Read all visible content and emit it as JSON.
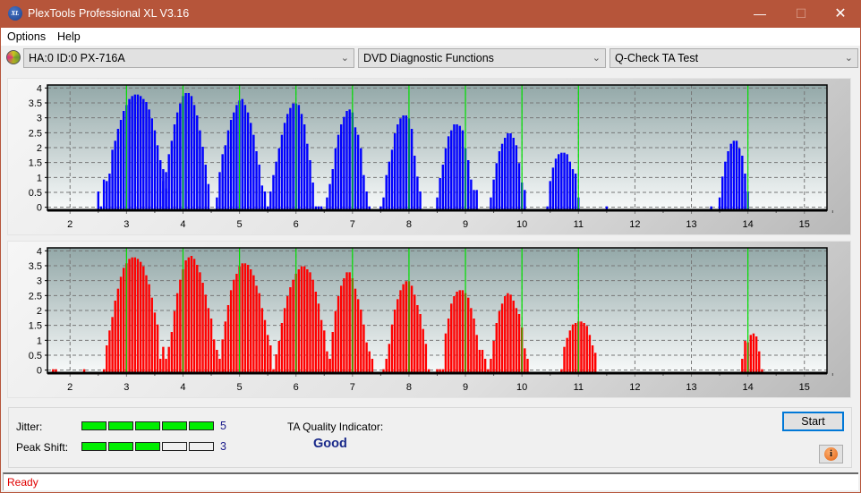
{
  "window": {
    "title": "PlexTools Professional XL V3.16",
    "icon": "xl-logo-icon",
    "controls": [
      "minimize",
      "maximize",
      "close"
    ]
  },
  "menu": [
    {
      "label": "Options"
    },
    {
      "label": "Help"
    }
  ],
  "toolbar": {
    "drive": "HA:0 ID:0  PX-716A",
    "function": "DVD Diagnostic Functions",
    "test": "Q-Check TA Test"
  },
  "results": {
    "jitter_label": "Jitter:",
    "jitter_value": "5",
    "jitter_level": 5,
    "peak_shift_label": "Peak Shift:",
    "peak_shift_value": "3",
    "peak_shift_level": 3,
    "max_level": 5,
    "ta_quality_label": "TA Quality Indicator:",
    "ta_quality_value": "Good",
    "level_color": "#00ee00"
  },
  "buttons": {
    "start": "Start",
    "info": "i"
  },
  "status": {
    "text": "Ready",
    "color": "#e00000"
  },
  "chart_data": [
    {
      "type": "bar",
      "name": "top-chart",
      "color": "#0000ff",
      "marker_color": "#00e000",
      "x_ticks": [
        2,
        3,
        4,
        5,
        6,
        7,
        8,
        9,
        10,
        11,
        12,
        13,
        14,
        15
      ],
      "y_ticks": [
        "0",
        "0.5",
        "1",
        "1.5",
        "2",
        "2.5",
        "3",
        "3.5",
        "4"
      ],
      "xlim": [
        1.6,
        15.4
      ],
      "ylim": [
        -0.1,
        4.1
      ],
      "grid": true,
      "markers": [
        3,
        4,
        5,
        6,
        7,
        8,
        9,
        10,
        11,
        14
      ],
      "bin_step": 0.05,
      "peaks": [
        {
          "start": 2.5,
          "values": [
            0.5,
            0.0,
            0.9,
            0.85,
            1.1,
            1.9,
            2.2,
            2.6,
            2.9,
            3.2,
            3.4,
            3.6,
            3.7,
            3.75,
            3.75,
            3.7,
            3.6,
            3.5,
            3.25,
            2.95,
            2.55,
            2.05,
            1.55,
            1.25,
            0.6
          ]
        },
        {
          "start": 3.65,
          "values": [
            0.85,
            1.15,
            1.75,
            2.2,
            2.75,
            3.15,
            3.45,
            3.7,
            3.8,
            3.8,
            3.7,
            3.4,
            3.05,
            2.55,
            2.0,
            1.4,
            0.75
          ]
        },
        {
          "start": 4.6,
          "values": [
            0.3,
            1.15,
            1.75,
            2.05,
            2.55,
            2.9,
            3.15,
            3.4,
            3.55,
            3.6,
            3.4,
            3.15,
            2.8,
            2.4,
            1.85,
            1.4,
            0.7,
            0.5
          ]
        },
        {
          "start": 5.5,
          "values": [
            0.0,
            0.5,
            1.05,
            1.5,
            1.95,
            2.4,
            2.8,
            3.1,
            3.3,
            3.45,
            3.45,
            3.4,
            3.1,
            2.75,
            2.1,
            1.55,
            0.8,
            0.0,
            0.0,
            0.0
          ]
        },
        {
          "start": 6.55,
          "values": [
            0.3,
            0.75,
            1.25,
            1.95,
            2.4,
            2.75,
            3.0,
            3.2,
            3.25,
            3.15,
            2.65,
            2.4,
            1.95,
            1.05,
            0.5,
            0.0
          ]
        },
        {
          "start": 7.5,
          "values": [
            0.0,
            0.3,
            1.05,
            1.5,
            1.9,
            2.45,
            2.75,
            2.95,
            3.05,
            3.05,
            2.95,
            2.6,
            1.7,
            1.0,
            0.5
          ]
        },
        {
          "start": 8.5,
          "values": [
            0.3,
            0.95,
            1.4,
            1.95,
            2.35,
            2.55,
            2.75,
            2.75,
            2.7,
            2.55,
            1.95,
            1.55,
            0.9,
            0.55,
            0.55
          ]
        },
        {
          "start": 9.45,
          "values": [
            0.3,
            0.9,
            1.45,
            1.85,
            2.1,
            2.3,
            2.45,
            2.45,
            2.3,
            2.05,
            1.45,
            0.8,
            0.55
          ]
        },
        {
          "start": 10.45,
          "values": [
            0.0,
            0.85,
            1.3,
            1.6,
            1.75,
            1.8,
            1.8,
            1.75,
            1.5,
            1.25,
            1.1,
            0.3
          ]
        },
        {
          "start": 11.5,
          "values": [
            0.0
          ]
        },
        {
          "start": 13.35,
          "values": [
            0.0
          ]
        },
        {
          "start": 13.5,
          "values": [
            0.3,
            1.0,
            1.5,
            1.85,
            2.1,
            2.2,
            2.2,
            1.95,
            1.7,
            1.1,
            0.5
          ]
        }
      ]
    },
    {
      "type": "bar",
      "name": "bottom-chart",
      "color": "#ff0000",
      "marker_color": "#00e000",
      "x_ticks": [
        2,
        3,
        4,
        5,
        6,
        7,
        8,
        9,
        10,
        11,
        12,
        13,
        14,
        15
      ],
      "y_ticks": [
        "0",
        "0.5",
        "1",
        "1.5",
        "2",
        "2.5",
        "3",
        "3.5",
        "4"
      ],
      "xlim": [
        1.6,
        15.4
      ],
      "ylim": [
        -0.1,
        4.1
      ],
      "grid": true,
      "markers": [
        3,
        4,
        5,
        6,
        7,
        8,
        9,
        10,
        11,
        14
      ],
      "bin_step": 0.05,
      "peaks": [
        {
          "start": 1.7,
          "values": [
            0.0,
            0.0
          ]
        },
        {
          "start": 2.25,
          "values": [
            0.0
          ]
        },
        {
          "start": 2.6,
          "values": [
            0.0,
            0.8,
            1.3,
            1.75,
            2.3,
            2.7,
            3.1,
            3.4,
            3.55,
            3.7,
            3.75,
            3.75,
            3.7,
            3.6,
            3.45,
            3.15,
            2.85,
            2.4,
            1.9,
            1.5,
            0.35,
            0.75,
            0.35,
            0.75,
            1.25,
            1.95,
            2.55,
            3.0,
            3.35,
            3.65,
            3.75,
            3.8,
            3.7,
            3.5,
            3.25,
            2.9,
            2.5,
            2.05,
            1.7,
            1.0,
            0.65,
            0.35,
            0.0,
            0.0
          ]
        },
        {
          "start": 4.7,
          "values": [
            1.0,
            1.6,
            2.15,
            2.65,
            3.0,
            3.2,
            3.45,
            3.55,
            3.55,
            3.5,
            3.35,
            3.15,
            2.8,
            2.55,
            2.05,
            1.65,
            1.15,
            0.8,
            0.0,
            0.5,
            0.95,
            1.55,
            2.05,
            2.45,
            2.75,
            3.0,
            3.2,
            3.35,
            3.45,
            3.45,
            3.35,
            3.25,
            3.0,
            2.6,
            2.2,
            1.65,
            1.3,
            0.6,
            0.35,
            0.0
          ]
        },
        {
          "start": 6.6,
          "values": [
            0.35,
            1.25,
            1.95,
            2.45,
            2.8,
            3.05,
            3.25,
            3.25,
            3.05,
            2.7,
            2.35,
            2.0,
            1.5,
            0.9,
            0.6,
            0.35
          ]
        },
        {
          "start": 7.55,
          "values": [
            0.0,
            0.35,
            0.85,
            1.5,
            2.0,
            2.35,
            2.65,
            2.85,
            2.95,
            2.95,
            2.8,
            2.5,
            2.15,
            1.85,
            1.35,
            0.85,
            0.0
          ]
        },
        {
          "start": 8.5,
          "values": [
            0.0,
            0.0,
            0.0,
            1.2,
            1.7,
            2.2,
            2.45,
            2.6,
            2.65,
            2.65,
            2.55,
            2.4,
            2.05,
            1.7,
            1.15,
            0.65,
            0.65,
            0.35,
            0.0
          ]
        },
        {
          "start": 9.45,
          "values": [
            0.35,
            0.95,
            1.55,
            1.95,
            2.2,
            2.45,
            2.55,
            2.5,
            2.3,
            2.05,
            1.85,
            1.4,
            0.7,
            0.35
          ]
        },
        {
          "start": 10.7,
          "values": [
            0.0,
            0.75,
            1.05,
            1.3,
            1.5,
            1.55,
            1.6,
            1.6,
            1.55,
            1.45,
            1.15,
            0.8,
            0.55
          ]
        },
        {
          "start": 13.9,
          "values": [
            0.35,
            0.95,
            0.9,
            1.15,
            1.2,
            1.1,
            0.6,
            0.0
          ]
        }
      ]
    }
  ]
}
